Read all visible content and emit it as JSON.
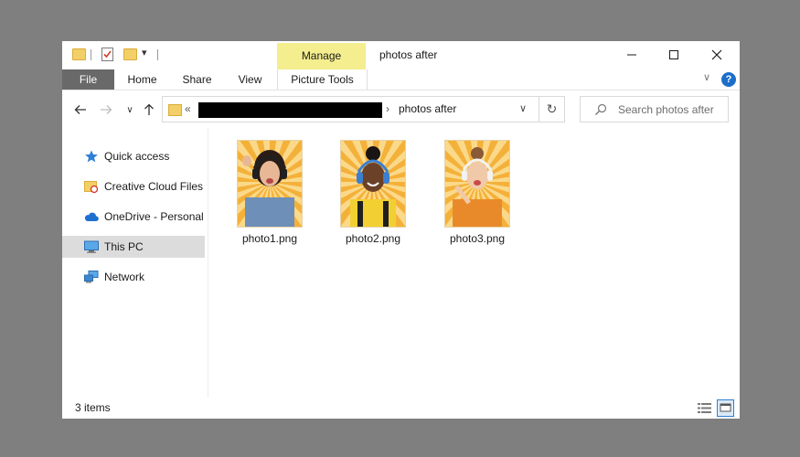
{
  "window": {
    "title": "photos after",
    "contextual_group": "Manage",
    "controls": {
      "minimize_icon": "minimize-icon",
      "maximize_icon": "maximize-icon",
      "close_icon": "close-icon"
    }
  },
  "ribbon": {
    "tabs": [
      {
        "label": "File",
        "active_style": "dark"
      },
      {
        "label": "Home"
      },
      {
        "label": "Share"
      },
      {
        "label": "View"
      },
      {
        "label": "Picture Tools"
      }
    ],
    "help_label": "?"
  },
  "address": {
    "prefix": "«",
    "current_folder": "photos after",
    "separator": "›"
  },
  "search": {
    "placeholder": "Search photos after"
  },
  "sidebar": {
    "items": [
      {
        "label": "Quick access",
        "icon": "star-icon"
      },
      {
        "label": "Creative Cloud Files",
        "icon": "creative-cloud-folder-icon"
      },
      {
        "label": "OneDrive - Personal",
        "icon": "cloud-icon"
      },
      {
        "label": "This PC",
        "icon": "computer-icon",
        "selected": true
      },
      {
        "label": "Network",
        "icon": "network-icon"
      }
    ]
  },
  "files": [
    {
      "name": "photo1.png"
    },
    {
      "name": "photo2.png"
    },
    {
      "name": "photo3.png"
    }
  ],
  "status": {
    "item_count": "3 items"
  },
  "colors": {
    "manage_highlight": "#f4ee8f",
    "file_tab": "#696969",
    "accent_blue": "#1c6ec9"
  }
}
